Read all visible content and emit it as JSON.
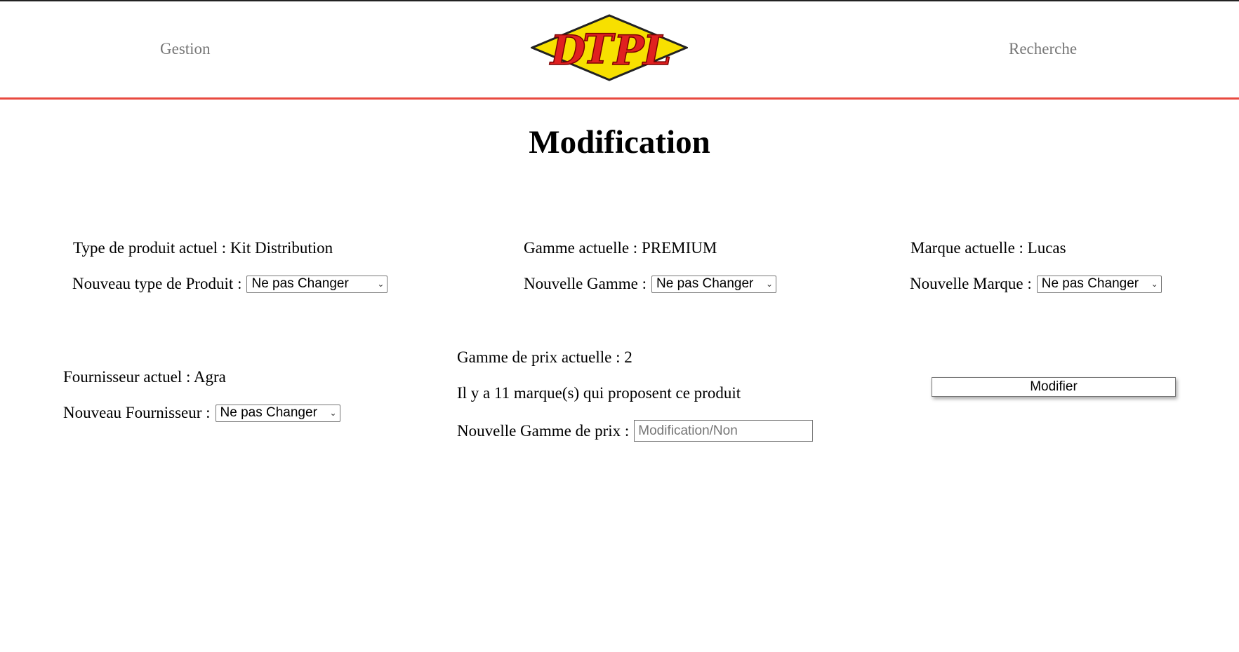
{
  "nav": {
    "left_label": "Gestion",
    "right_label": "Recherche"
  },
  "logo": {
    "text": "DTPL",
    "colors": {
      "diamond": "#f7e000",
      "letters": "#e02020",
      "outline": "#222222"
    }
  },
  "page": {
    "title": "Modification",
    "accent_color": "#e8493f"
  },
  "product_type": {
    "current_label": "Type de produit actuel : Kit Distribution",
    "new_label": "Nouveau type de Produit :",
    "select_value": "Ne pas Changer"
  },
  "gamme": {
    "current_label": "Gamme actuelle : PREMIUM",
    "new_label": "Nouvelle Gamme :",
    "select_value": "Ne pas Changer"
  },
  "marque": {
    "current_label": "Marque actuelle : Lucas",
    "new_label": "Nouvelle Marque :",
    "select_value": "Ne pas Changer"
  },
  "fournisseur": {
    "current_label": "Fournisseur actuel : Agra",
    "new_label": "Nouveau Fournisseur :",
    "select_value": "Ne pas Changer"
  },
  "prix": {
    "current_label": "Gamme de prix actuelle : 2",
    "brands_info": "Il y a 11 marque(s) qui proposent ce produit",
    "new_label": "Nouvelle Gamme de prix :",
    "input_value": "",
    "input_placeholder": "Modification/Non"
  },
  "submit": {
    "label": "Modifier"
  }
}
